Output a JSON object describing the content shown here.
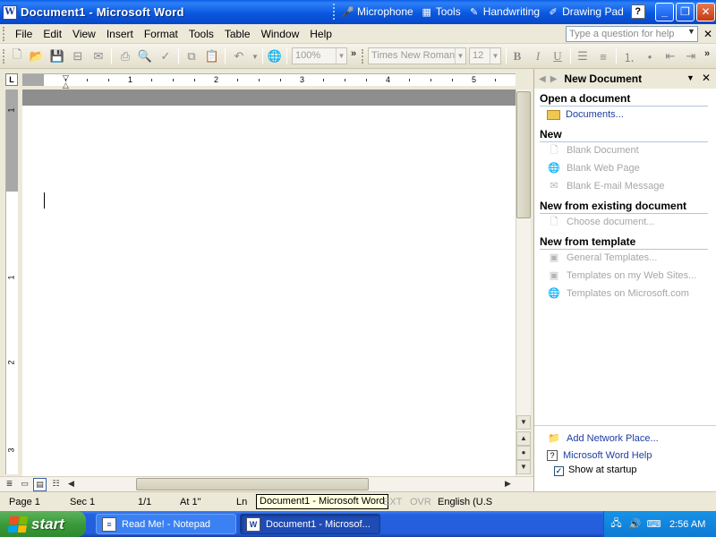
{
  "window": {
    "title": "Document1 - Microsoft Word",
    "app_icon_letter": "W",
    "min_label": "_",
    "max_label": "❐",
    "close_label": "✕"
  },
  "language_bar": {
    "items": [
      {
        "label": "Microphone",
        "icon": "microphone-icon"
      },
      {
        "label": "Tools",
        "icon": "tools-icon"
      },
      {
        "label": "Handwriting",
        "icon": "handwriting-icon"
      },
      {
        "label": "Drawing Pad",
        "icon": "drawing-pad-icon"
      }
    ],
    "help_label": "?"
  },
  "menu": {
    "items": [
      "File",
      "Edit",
      "View",
      "Insert",
      "Format",
      "Tools",
      "Table",
      "Window",
      "Help"
    ],
    "ask_placeholder": "Type a question for help",
    "close_label": "✕"
  },
  "toolbar": {
    "zoom": "100%",
    "font_name": "Times New Roman",
    "font_size": "12",
    "bold": "B",
    "italic": "I",
    "underline": "U",
    "chevron": "»"
  },
  "ruler": {
    "tab_button": "L",
    "numbers": [
      "1",
      "2",
      "3",
      "4",
      "5"
    ],
    "vertical_numbers": [
      "1",
      "1",
      "2",
      "3"
    ]
  },
  "task_pane": {
    "title": "New Document",
    "sections": {
      "open": "Open a document",
      "new": "New",
      "existing": "New from existing document",
      "template": "New from template"
    },
    "open_links": [
      "Documents..."
    ],
    "new_links": [
      "Blank Document",
      "Blank Web Page",
      "Blank E-mail Message"
    ],
    "existing_links": [
      "Choose document..."
    ],
    "template_links": [
      "General Templates...",
      "Templates on my Web Sites...",
      "Templates on Microsoft.com"
    ],
    "bottom_links": [
      "Add Network Place...",
      "Microsoft Word Help"
    ],
    "show_at_startup": "Show at startup",
    "show_at_startup_checked": "✓"
  },
  "status_bar": {
    "page": "Page  1",
    "sec": "Sec  1",
    "page_of": "1/1",
    "at": "At  1\"",
    "ln": "Ln",
    "tooltip": "Document1 - Microsoft Word",
    "ext": "EXT",
    "ovr": "OVR",
    "language": "English (U.S"
  },
  "taskbar": {
    "start_label": "start",
    "buttons": [
      {
        "label": "Read Me! - Notepad",
        "icon": "notepad-icon"
      },
      {
        "label": "Document1 - Microsof...",
        "icon": "word-icon",
        "active": true
      }
    ],
    "clock": "2:56 AM"
  },
  "colors": {
    "title_blue": "#0a58e0",
    "link_blue": "#1d3da3",
    "disabled_gray": "#a6a6a6",
    "taskbar_blue": "#245edb",
    "start_green": "#3a9a3a",
    "tray_blue": "#0e7ad4"
  }
}
